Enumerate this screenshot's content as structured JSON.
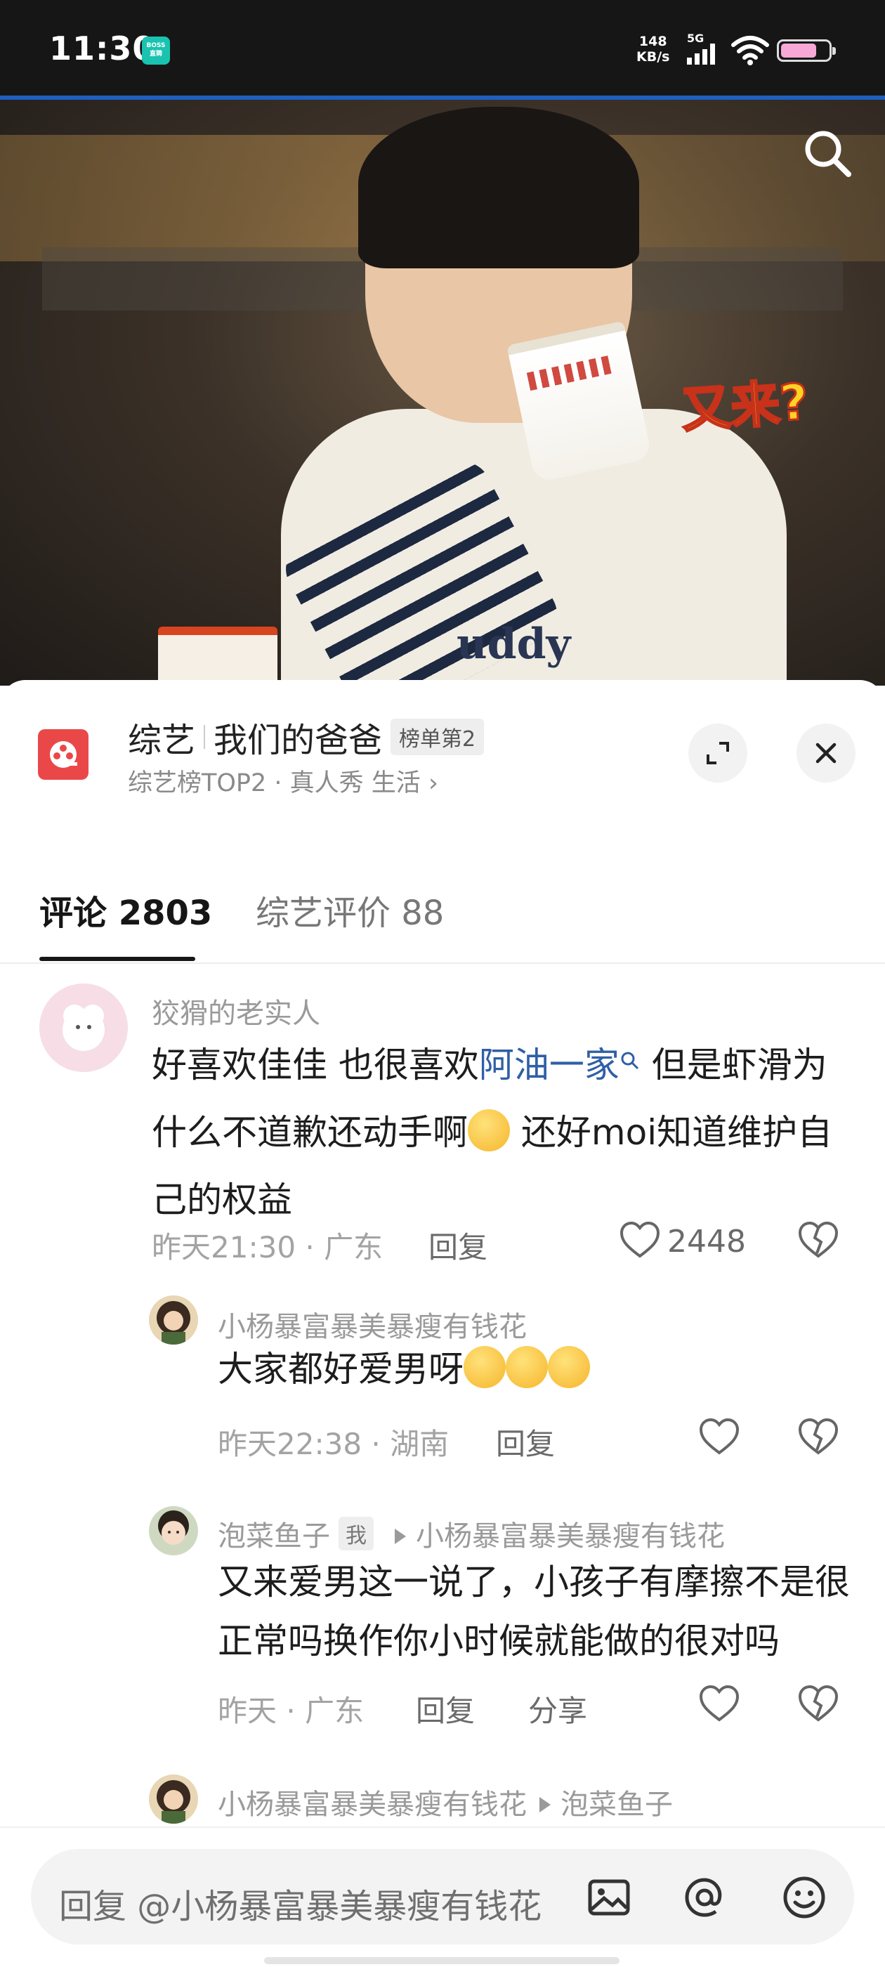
{
  "status_bar": {
    "time": "11:30",
    "app_badge": "BOSS直聘",
    "speed_value": "148",
    "speed_unit": "KB/s",
    "network": "5G",
    "battery_color": "#f8a8d6",
    "battery_level": 0.75
  },
  "video": {
    "overlay_text": "又来?",
    "shirt_text": "uddy",
    "search_icon": "search-icon"
  },
  "show": {
    "category": "综艺",
    "title": "我们的爸爸",
    "rank_badge": "榜单第2",
    "subtitle": "综艺榜TOP2 · 真人秀 生活",
    "expand_icon": "expand-icon",
    "close_icon": "close-icon"
  },
  "tabs": {
    "comments": "评论 2803",
    "ratings": "综艺评价 88"
  },
  "comments": [
    {
      "user": "狡猾的老实人",
      "text_1": "好喜欢佳佳 也很喜欢",
      "link": "阿油一家",
      "text_2": " 但是虾滑为什么不道歉还动手啊",
      "text_3": " 还好moi知道维护自己的权益",
      "time": "昨天21:30",
      "location": "广东",
      "reply_label": "回复",
      "likes": "2448"
    },
    {
      "user": "小杨暴富暴美暴瘦有钱花",
      "text": "大家都好爱男呀",
      "time": "昨天22:38",
      "location": "湖南",
      "reply_label": "回复"
    },
    {
      "user": "泡菜鱼子",
      "me_badge": "我",
      "reply_to": "小杨暴富暴美暴瘦有钱花",
      "text": "又来爱男这一说了，小孩子有摩擦不是很正常吗换作你小时候就能做的很对吗",
      "time": "昨天",
      "location": "广东",
      "reply_label": "回复",
      "share_label": "分享"
    },
    {
      "user": "小杨暴富暴美暴瘦有钱花",
      "reply_to": "泡菜鱼子"
    }
  ],
  "input": {
    "placeholder": "回复 @小杨暴富暴美暴瘦有钱花"
  },
  "colors": {
    "link": "#2f5fa6",
    "show_icon": "#ea4848",
    "tab_active": "#161616"
  }
}
